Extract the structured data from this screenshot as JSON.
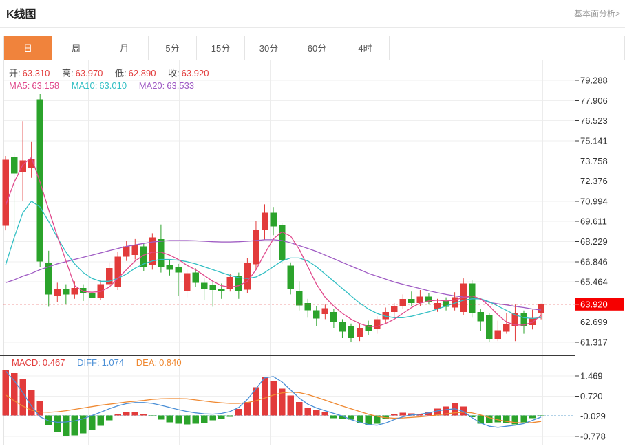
{
  "header": {
    "title": "K线图",
    "link": "基本面分析>"
  },
  "tabs": {
    "items": [
      "日",
      "周",
      "月",
      "5分",
      "15分",
      "30分",
      "60分",
      "4时"
    ],
    "selected": "日"
  },
  "legend": {
    "ohlc": {
      "open_label": "开:",
      "open": "63.310",
      "high_label": "高:",
      "high": "63.970",
      "low_label": "低:",
      "low": "62.890",
      "close_label": "收:",
      "close": "63.920"
    },
    "ma": {
      "ma5_label": "MA5:",
      "ma5": "63.158",
      "ma10_label": "MA10:",
      "ma10": "63.010",
      "ma20_label": "MA20:",
      "ma20": "63.533"
    },
    "macd": {
      "macd_label": "MACD:",
      "macd": "0.467",
      "diff_label": "DIFF:",
      "diff": "1.074",
      "dea_label": "DEA:",
      "dea": "0.840"
    }
  },
  "colors": {
    "bull_red": "#e23b3b",
    "bear_green": "#2ba32b",
    "price_tag_bg": "#f60000",
    "price_tag_text": "#ffffff",
    "ma5": "#e0498c",
    "ma10": "#33bfc4",
    "ma20": "#9f5bc4",
    "diff_line": "#4b8fd6",
    "dea_line": "#ef8932",
    "dotted_price_line": "#e23b3b",
    "macd_zero_line": "#a8cce4",
    "tab_selected_bg": "#f0833c",
    "value_red": "#e23b3b",
    "axis_text": "#333333",
    "grid": "#efefef",
    "vgrid": "#ececec",
    "border": "#e4e4e4",
    "axis_line": "#3a3a3a",
    "link_gray": "#999999"
  },
  "chart_data": {
    "type": "candlestick",
    "title": "K线图 日线 (daily K-line with MA5/MA10/MA20 and MACD sub-chart)",
    "legend_position": "top-left",
    "grid": "on",
    "price_axis": {
      "side": "right",
      "ticks": [
        79.288,
        77.906,
        76.523,
        75.141,
        73.758,
        72.376,
        70.994,
        69.611,
        68.229,
        66.846,
        65.464,
        62.699,
        61.317
      ],
      "unlabeled_tick": 64.082,
      "range": [
        60.42,
        80.66
      ],
      "current_price": 63.92,
      "current_price_label": "63.920"
    },
    "macd_axis": {
      "side": "right",
      "ticks": [
        1.469,
        0.72,
        -0.029,
        -0.778
      ],
      "range": [
        -1.11,
        2.24
      ]
    },
    "v_gridlines_x": [
      128,
      260,
      392,
      524,
      656,
      788
    ],
    "candles": [
      [
        69.3,
        74.1,
        69.0,
        73.85
      ],
      [
        74.0,
        74.35,
        67.9,
        72.9
      ],
      [
        73.0,
        76.5,
        71.0,
        73.8
      ],
      [
        73.3,
        75.1,
        72.6,
        73.9
      ],
      [
        78.0,
        78.35,
        66.5,
        66.85
      ],
      [
        66.8,
        67.6,
        63.75,
        64.6
      ],
      [
        64.5,
        65.4,
        64.1,
        64.95
      ],
      [
        65.0,
        65.3,
        63.9,
        64.6
      ],
      [
        64.6,
        65.5,
        64.3,
        65.05
      ],
      [
        65.05,
        65.3,
        64.15,
        64.7
      ],
      [
        64.7,
        65.0,
        63.9,
        64.35
      ],
      [
        64.35,
        65.6,
        64.2,
        65.3
      ],
      [
        65.3,
        66.8,
        65.1,
        66.4
      ],
      [
        65.1,
        67.5,
        64.9,
        67.2
      ],
      [
        67.2,
        68.3,
        66.9,
        67.9
      ],
      [
        67.3,
        68.4,
        67.0,
        68.0
      ],
      [
        67.9,
        68.1,
        66.2,
        66.5
      ],
      [
        66.6,
        68.8,
        66.3,
        68.5
      ],
      [
        68.4,
        69.4,
        66.1,
        66.5
      ],
      [
        66.6,
        67.0,
        65.9,
        66.3
      ],
      [
        66.45,
        66.7,
        64.5,
        66.1
      ],
      [
        64.8,
        66.3,
        64.4,
        66.05
      ],
      [
        66.1,
        66.4,
        65.1,
        65.4
      ],
      [
        65.4,
        65.7,
        64.2,
        65.0
      ],
      [
        65.25,
        65.5,
        63.75,
        64.9
      ],
      [
        65.0,
        65.35,
        64.3,
        64.85
      ],
      [
        65.0,
        66.0,
        64.8,
        65.8
      ],
      [
        65.9,
        66.1,
        64.3,
        64.8
      ],
      [
        64.93,
        67.1,
        64.7,
        66.77
      ],
      [
        66.68,
        69.65,
        66.3,
        69.04
      ],
      [
        69.04,
        70.78,
        68.33,
        70.22
      ],
      [
        70.22,
        70.6,
        68.66,
        69.27
      ],
      [
        69.37,
        69.5,
        66.7,
        66.92
      ],
      [
        66.58,
        66.8,
        64.6,
        65.0
      ],
      [
        64.8,
        65.5,
        63.5,
        63.85
      ],
      [
        64.0,
        64.3,
        63.0,
        63.5
      ],
      [
        63.5,
        63.8,
        62.4,
        62.95
      ],
      [
        63.25,
        63.9,
        62.9,
        63.65
      ],
      [
        63.4,
        63.6,
        62.3,
        62.7
      ],
      [
        62.7,
        62.9,
        61.6,
        62.05
      ],
      [
        62.4,
        62.6,
        61.35,
        61.6
      ],
      [
        61.7,
        62.6,
        61.4,
        62.3
      ],
      [
        62.5,
        62.8,
        61.8,
        62.1
      ],
      [
        62.2,
        63.1,
        61.9,
        62.9
      ],
      [
        62.9,
        63.7,
        62.6,
        63.4
      ],
      [
        63.4,
        64.0,
        63.0,
        63.8
      ],
      [
        63.8,
        64.6,
        63.6,
        64.3
      ],
      [
        64.3,
        64.8,
        63.8,
        64.0
      ],
      [
        64.0,
        64.9,
        63.8,
        64.45
      ],
      [
        64.45,
        64.7,
        63.9,
        64.1
      ],
      [
        63.6,
        64.3,
        63.4,
        64.0
      ],
      [
        64.15,
        64.4,
        63.5,
        63.75
      ],
      [
        63.7,
        64.75,
        63.5,
        64.4
      ],
      [
        63.4,
        65.7,
        63.2,
        65.35
      ],
      [
        65.35,
        65.6,
        63.0,
        63.3
      ],
      [
        63.4,
        63.6,
        62.1,
        62.75
      ],
      [
        63.2,
        63.3,
        61.32,
        61.55
      ],
      [
        61.55,
        62.8,
        61.4,
        62.15
      ],
      [
        62.05,
        63.3,
        61.9,
        62.57
      ],
      [
        62.4,
        63.9,
        61.4,
        63.35
      ],
      [
        63.35,
        63.5,
        61.9,
        62.4
      ],
      [
        62.5,
        63.55,
        62.2,
        63.0
      ],
      [
        63.31,
        63.97,
        62.89,
        63.92
      ]
    ],
    "ma5": [
      70.7,
      72.3,
      73.5,
      74.0,
      72.3,
      70.4,
      68.6,
      66.9,
      65.2,
      64.8,
      64.75,
      64.8,
      65.1,
      65.7,
      66.3,
      66.9,
      67.3,
      67.5,
      67.5,
      67.3,
      67.0,
      66.6,
      66.3,
      65.9,
      65.5,
      65.2,
      65.1,
      65.2,
      65.5,
      66.3,
      67.4,
      68.4,
      68.9,
      68.6,
      67.7,
      66.5,
      65.3,
      64.4,
      63.8,
      63.3,
      62.9,
      62.6,
      62.4,
      62.4,
      62.6,
      62.9,
      63.3,
      63.7,
      64.0,
      64.15,
      64.2,
      64.15,
      64.2,
      64.4,
      64.5,
      64.3,
      63.8,
      63.2,
      62.7,
      62.5,
      62.5,
      62.7,
      63.16
    ],
    "ma10": [
      66.6,
      68.5,
      70.2,
      71.0,
      70.6,
      69.6,
      68.5,
      67.5,
      66.7,
      66.1,
      65.7,
      65.5,
      65.5,
      65.7,
      66.0,
      66.4,
      66.7,
      66.9,
      67.0,
      67.0,
      66.95,
      66.85,
      66.7,
      66.5,
      66.3,
      66.1,
      65.9,
      65.75,
      65.7,
      65.8,
      66.1,
      66.5,
      66.9,
      67.1,
      67.1,
      66.9,
      66.5,
      66.0,
      65.5,
      65.0,
      64.5,
      64.0,
      63.6,
      63.3,
      63.1,
      63.0,
      63.0,
      63.1,
      63.25,
      63.4,
      63.6,
      63.8,
      64.0,
      64.2,
      64.3,
      64.3,
      64.1,
      63.8,
      63.5,
      63.2,
      63.0,
      62.95,
      63.01
    ],
    "ma20": [
      65.4,
      65.6,
      65.85,
      66.05,
      66.3,
      66.5,
      66.7,
      66.85,
      67.0,
      67.15,
      67.3,
      67.45,
      67.6,
      67.75,
      67.9,
      68.0,
      68.1,
      68.2,
      68.25,
      68.3,
      68.3,
      68.3,
      68.28,
      68.25,
      68.22,
      68.2,
      68.2,
      68.22,
      68.25,
      68.3,
      68.35,
      68.35,
      68.3,
      68.15,
      67.95,
      67.75,
      67.55,
      67.3,
      67.05,
      66.8,
      66.55,
      66.3,
      66.05,
      65.85,
      65.65,
      65.45,
      65.3,
      65.15,
      65.0,
      64.85,
      64.72,
      64.6,
      64.5,
      64.42,
      64.35,
      64.28,
      64.05,
      63.95,
      63.88,
      63.78,
      63.7,
      63.6,
      63.53
    ],
    "macd": {
      "histogram": [
        1.7,
        1.58,
        1.35,
        0.95,
        0.55,
        -0.35,
        -0.62,
        -0.78,
        -0.74,
        -0.66,
        -0.52,
        -0.38,
        -0.18,
        0.06,
        0.14,
        0.12,
        0.06,
        -0.04,
        -0.15,
        -0.25,
        -0.3,
        -0.33,
        -0.3,
        -0.28,
        -0.18,
        -0.12,
        -0.05,
        0.25,
        0.5,
        1.05,
        1.45,
        1.3,
        1.0,
        0.75,
        0.5,
        0.3,
        0.2,
        0.12,
        -0.1,
        -0.12,
        -0.15,
        -0.28,
        -0.35,
        -0.3,
        -0.12,
        0.06,
        0.1,
        0.08,
        0.06,
        0.12,
        0.26,
        0.33,
        0.45,
        0.33,
        -0.06,
        -0.3,
        -0.28,
        -0.25,
        -0.28,
        -0.33,
        -0.25,
        -0.1,
        -0.04
      ],
      "diff": [
        1.66,
        1.3,
        0.85,
        0.35,
        -0.05,
        -0.2,
        -0.25,
        -0.24,
        -0.2,
        -0.12,
        0.0,
        0.12,
        0.25,
        0.36,
        0.44,
        0.48,
        0.48,
        0.45,
        0.38,
        0.3,
        0.22,
        0.15,
        0.1,
        0.06,
        0.05,
        0.08,
        0.15,
        0.3,
        0.6,
        1.0,
        1.4,
        1.45,
        1.25,
        0.95,
        0.65,
        0.42,
        0.28,
        0.18,
        0.08,
        -0.02,
        -0.15,
        -0.25,
        -0.33,
        -0.36,
        -0.28,
        -0.15,
        -0.05,
        0.02,
        0.05,
        0.1,
        0.17,
        0.22,
        0.25,
        0.15,
        -0.08,
        -0.28,
        -0.4,
        -0.44,
        -0.4,
        -0.36,
        -0.3,
        -0.18,
        -0.06
      ],
      "dea": [
        0.77,
        0.55,
        0.35,
        0.2,
        0.13,
        0.12,
        0.14,
        0.18,
        0.23,
        0.28,
        0.33,
        0.38,
        0.42,
        0.46,
        0.5,
        0.53,
        0.56,
        0.6,
        0.62,
        0.63,
        0.63,
        0.62,
        0.58,
        0.54,
        0.5,
        0.47,
        0.45,
        0.45,
        0.48,
        0.55,
        0.65,
        0.76,
        0.84,
        0.87,
        0.85,
        0.78,
        0.68,
        0.57,
        0.46,
        0.35,
        0.25,
        0.15,
        0.05,
        -0.03,
        -0.08,
        -0.1,
        -0.09,
        -0.07,
        -0.05,
        -0.02,
        0.02,
        0.06,
        0.1,
        0.12,
        0.1,
        0.02,
        -0.08,
        -0.16,
        -0.22,
        -0.26,
        -0.28,
        -0.26,
        -0.22
      ]
    }
  }
}
